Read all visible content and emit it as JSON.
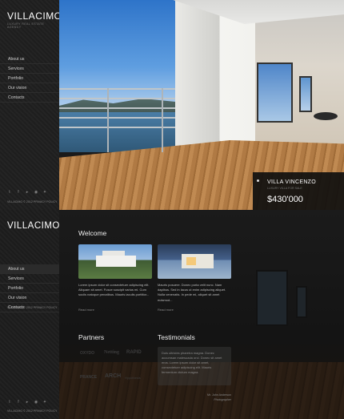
{
  "site": {
    "logo": "VILLACIMO",
    "tagline": "LUXURY REAL ESTATE AGENCY",
    "nav": [
      "About us",
      "Services",
      "Portfolio",
      "Our vision",
      "Contacts"
    ],
    "copyright": "VILLACIMO © 2012 PRIVACY POLICY",
    "social_icons": [
      "twitter-icon",
      "facebook-icon",
      "youtube-icon",
      "rss-icon",
      "settings-icon"
    ]
  },
  "top": {
    "feature": {
      "title": "VILLA VINCENZO",
      "subtitle": "LUXURY VILLA FOR SALE",
      "price": "$430'000"
    }
  },
  "bottom": {
    "active_nav": "About us",
    "welcome": {
      "title": "Welcome",
      "items": [
        {
          "text": "Lorem ipsum dolor sit consectetuer adipiscing elit. Aliquam sit amet. Fusce suscipit varius mi. Cum sociis natoque penatibus. Mauris iaculis porttitor...",
          "more": "Read more"
        },
        {
          "text": "Mauris posuere. Donec porta velit nunc. Nam dapibus. Sed in lacus ut enim adipiscing aliquet. Nulla venenatis. In pede mi, aliquet sit amet euismod...",
          "more": "Read more"
        }
      ]
    },
    "partners": {
      "title": "Partners",
      "logos": [
        "OXYDO",
        "Netting",
        "RAPID",
        "PRANCE",
        "ARCH",
        "Hypothesis"
      ]
    },
    "testimonials": {
      "title": "Testimonials",
      "quote": "Duis ultricies pharetra magna. Donec accumsan malesuada orci. Donec sit amet eros. Lorem ipsum dolor sit amet, consectetuer adipiscing elit. Mauris fermentum dictum magna.",
      "author": "Mr. John Anderson",
      "author_role": "Photographer"
    }
  }
}
